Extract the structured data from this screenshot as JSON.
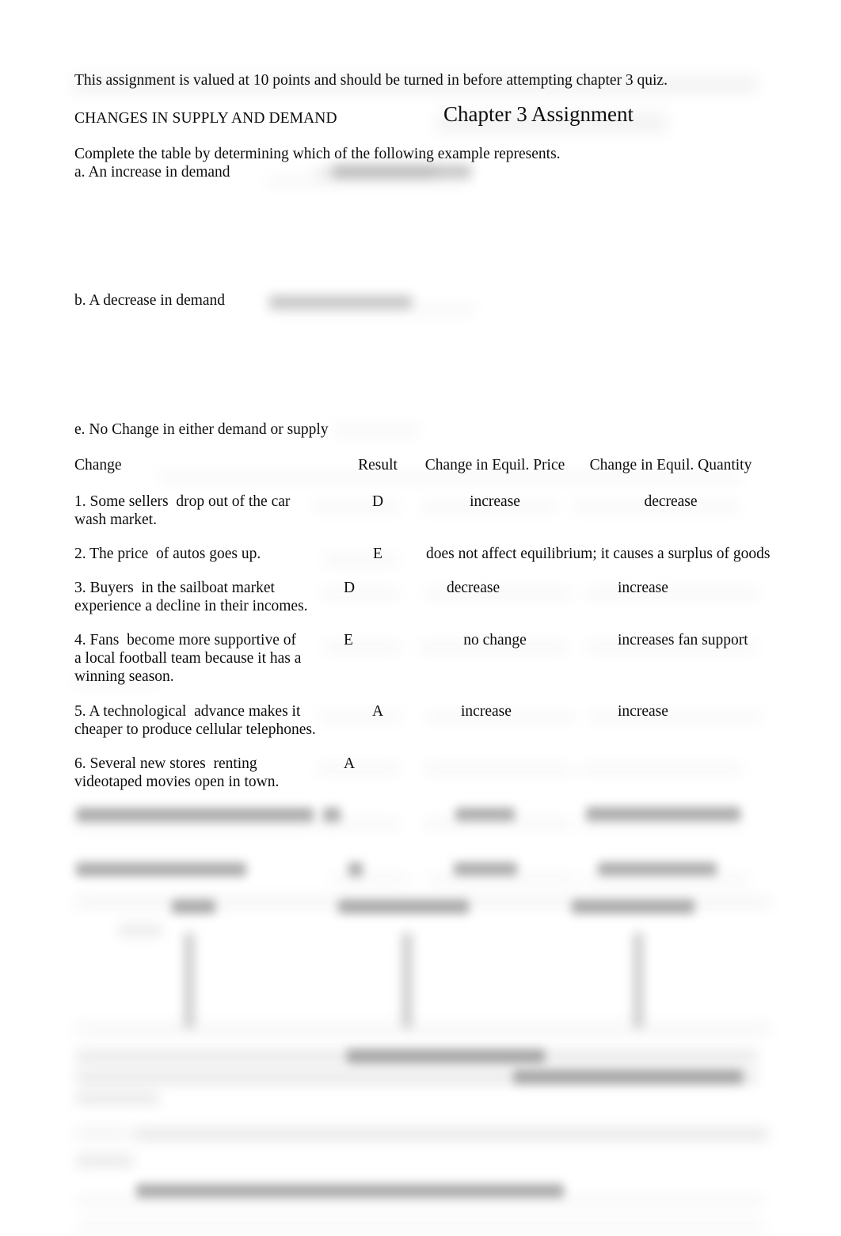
{
  "document": {
    "intro_line": "This assignment is valued at 10 points and should be turned in before attempting chapter 3 quiz.",
    "section_heading": "CHANGES IN SUPPLY AND DEMAND",
    "title": "Chapter 3 Assignment",
    "instruction": "Complete the table by determining which of the following example represents.",
    "options": [
      {
        "key": "a",
        "label": "a. An increase in demand"
      },
      {
        "key": "b",
        "label": "b. A decrease in demand"
      },
      {
        "key": "e",
        "label": "e. No Change in either demand or supply"
      }
    ]
  },
  "table": {
    "headers": {
      "change": "Change",
      "result": "Result",
      "price": "Change in Equil. Price",
      "quantity": "Change in Equil. Quantity"
    },
    "rows": [
      {
        "change": "1. Some sellers  drop out of the car\nwash market.",
        "result": "D",
        "price": "increase",
        "quantity": "decrease",
        "spans_columns": false
      },
      {
        "change": "2. The price  of autos goes up.",
        "result": "E",
        "price": "does not affect equilibrium; it causes a surplus of goods",
        "quantity": "",
        "spans_columns": true
      },
      {
        "change": "3. Buyers  in the sailboat market\nexperience a decline in their incomes.",
        "result": "D",
        "price": "decrease",
        "quantity": "increase",
        "spans_columns": false
      },
      {
        "change": "4. Fans  become more supportive of\na local football team because it has a\nwinning season.",
        "result": "E",
        "price": "no change",
        "quantity": "increases fan support",
        "spans_columns": false
      },
      {
        "change": "5. A technological  advance makes it\ncheaper to produce cellular telephones.",
        "result": "A",
        "price": "increase",
        "quantity": "increase",
        "spans_columns": false
      },
      {
        "change": "6. Several new stores  renting\nvideotaped movies open in town.",
        "result": "A",
        "price": "",
        "quantity": "",
        "spans_columns": false
      }
    ]
  },
  "redacted": {
    "note": "illegible",
    "count": 0
  }
}
